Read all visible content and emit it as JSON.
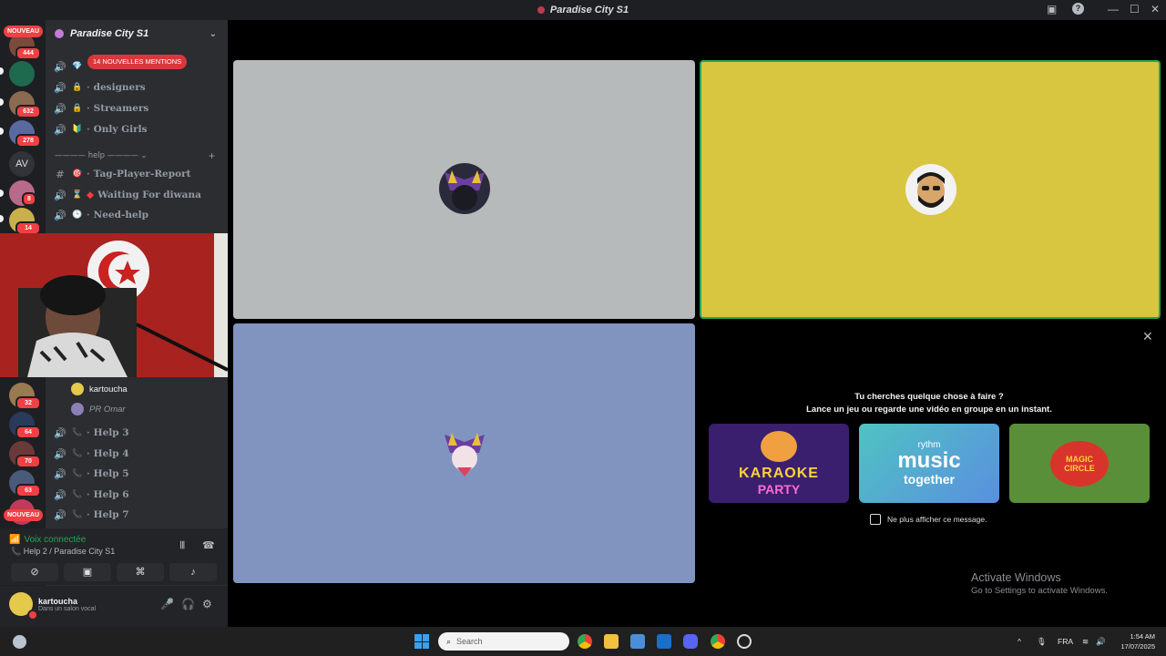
{
  "titlebar": {
    "title": "Paradise City S1",
    "help": "?",
    "minimize": "—",
    "maximize": "☐",
    "close": "✕"
  },
  "rail": {
    "new_top": "NOUVEAU",
    "new_bottom": "NOUVEAU",
    "av_label": "AV",
    "badges": [
      "444",
      "632",
      "278",
      "8",
      "14",
      "32",
      "64",
      "70",
      "63"
    ]
  },
  "server": {
    "name": "Paradise City S1",
    "mentions": "14 NOUVELLES MENTIONS"
  },
  "channels": [
    {
      "name": "designers",
      "emoji": "🔒"
    },
    {
      "name": "Streamers",
      "emoji": "🔒"
    },
    {
      "name": "Only Girls",
      "emoji": "🔰"
    }
  ],
  "category": {
    "label": "———— help ————",
    "chevron": "⌄",
    "add": "+"
  },
  "help_channels": [
    {
      "name": "Tag-Player-Report",
      "emoji": "🎯"
    },
    {
      "name": "Waiting For diwana",
      "emoji": "⌛"
    },
    {
      "name": "Need-help",
      "emoji": "🕒"
    }
  ],
  "voice_users": [
    "kartoucha",
    "PR Omar"
  ],
  "help_rooms": [
    "Help 3",
    "Help 4",
    "Help 5",
    "Help 6",
    "Help 7"
  ],
  "voice_panel": {
    "status": "Voix connectée",
    "channel": "Help 2 / Paradise City S1"
  },
  "user_panel": {
    "name": "kartoucha",
    "status": "Dans un salon vocal"
  },
  "activity": {
    "title_line1": "Tu cherches quelque chose à faire ?",
    "title_line2": "Lance un jeu ou regarde une vidéo en groupe en un instant.",
    "cards": [
      {
        "line1": "KARAOKE",
        "line2": "PARTY",
        "bg": "#3a1f6e"
      },
      {
        "line1": "rythm",
        "line2": "music",
        "line3": "together",
        "bg": "#3fb3c9"
      },
      {
        "line1": "MAGIC",
        "line2": "CIRCLE",
        "bg": "#5a8f3a"
      }
    ],
    "dont_show": "Ne plus afficher ce message.",
    "close": "✕"
  },
  "watermark": {
    "line1": "Activate Windows",
    "line2": "Go to Settings to activate Windows."
  },
  "taskbar": {
    "search_placeholder": "Search",
    "lang": "FRA",
    "time": "1:54 AM",
    "date": "17/07/2025"
  },
  "colors": {
    "accent_green": "#23a55a",
    "mention_red": "#da373c",
    "tile_gray": "#b6babb",
    "tile_yellow": "#d8c540",
    "tile_blue": "#8194c0"
  }
}
